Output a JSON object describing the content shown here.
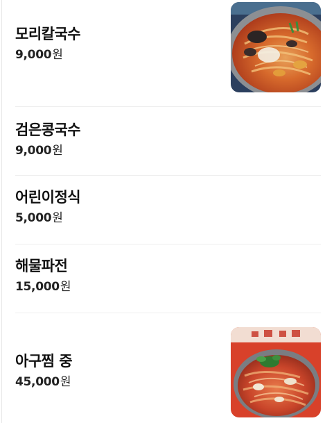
{
  "currency_unit": "원",
  "menu": {
    "items": [
      {
        "name": "모리칼국수",
        "price": "9,000",
        "image": "kalguksu-photo"
      },
      {
        "name": "검은콩국수",
        "price": "9,000"
      },
      {
        "name": "어린이정식",
        "price": "5,000"
      },
      {
        "name": "해물파전",
        "price": "15,000"
      },
      {
        "name": "아구찜 중",
        "price": "45,000",
        "image": "agujjim-photo"
      }
    ]
  },
  "colors": {
    "text": "#111111",
    "divider": "#eeeeee",
    "broth_red": "#c8441c",
    "dish_red": "#d8412a"
  }
}
